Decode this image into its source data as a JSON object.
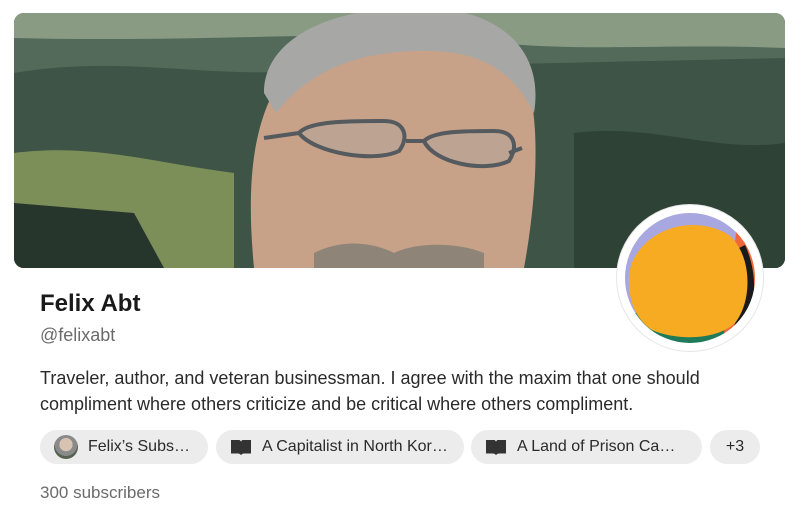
{
  "profile": {
    "name": "Felix Abt",
    "handle": "@felixabt",
    "bio": "Traveler, author, and veteran businessman. I agree with the maxim that one should compliment where others criticize and be critical where others compliment.",
    "subscribers": "300 subscribers"
  },
  "links": [
    {
      "label": "Felix’s Substack",
      "icon": "avatar-thumb-icon"
    },
    {
      "label": "A Capitalist in North Kor…",
      "icon": "book-icon"
    },
    {
      "label": "A Land of Prison Cam…",
      "icon": "book-icon"
    }
  ],
  "more_label": "+3",
  "colors": {
    "pill_bg": "#ececec",
    "avatar_orange": "#f6ab22",
    "avatar_green": "#1f7a5a",
    "avatar_coral": "#f0683a",
    "avatar_lavender": "#a9a7e0"
  }
}
